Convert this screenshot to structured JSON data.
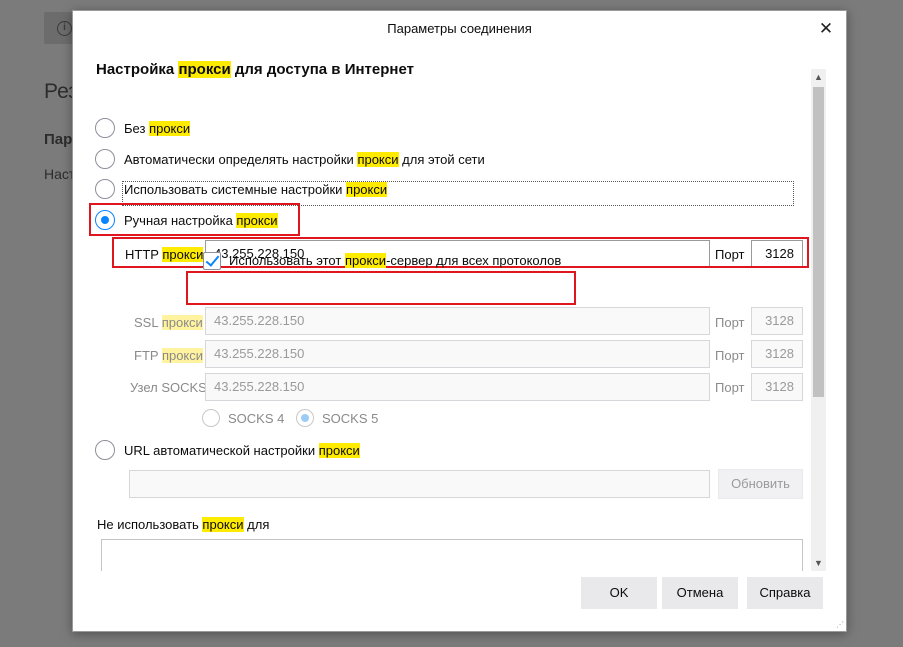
{
  "background": {
    "info_icon": "info-icon",
    "large_text": "Рез",
    "bold_text": "Пар",
    "small_text": "Наст"
  },
  "dialog": {
    "title": "Параметры соединения",
    "close_icon": "close-icon"
  },
  "section": {
    "heading_pre": "Настройка ",
    "heading_hl": "прокси",
    "heading_post": " для доступа в Интернет"
  },
  "radios": {
    "no_proxy": {
      "pre": "Без ",
      "hl": "прокси",
      "selected": false
    },
    "auto_detect": {
      "pre": "Автоматически определять настройки ",
      "hl": "прокси",
      "post": " для этой сети",
      "selected": false
    },
    "system": {
      "pre": "Использовать системные настройки ",
      "hl": "прокси",
      "selected": false
    },
    "manual": {
      "pre": "Ручная настройка ",
      "hl": "прокси",
      "selected": true
    },
    "auto_url": {
      "pre": "URL автоматической настройки ",
      "hl": "прокси",
      "selected": false
    }
  },
  "http": {
    "label_pre": "HTTP ",
    "label_hl": "прокси",
    "value": "43.255.228.150",
    "port_label": "Порт",
    "port": "3128"
  },
  "use_for_all": {
    "pre": "Использовать этот ",
    "hl": "прокси",
    "post": "-сервер для всех протоколов",
    "checked": true
  },
  "ssl": {
    "label_pre": "SSL ",
    "label_hl": "прокси",
    "value": "43.255.228.150",
    "port_label": "Порт",
    "port": "3128"
  },
  "ftp": {
    "label_pre": "FTP ",
    "label_hl": "прокси",
    "value": "43.255.228.150",
    "port_label": "Порт",
    "port": "3128"
  },
  "socks": {
    "label": "Узел SOCKS",
    "value": "43.255.228.150",
    "port_label": "Порт",
    "port": "3128",
    "v4": "SOCKS 4",
    "v5": "SOCKS 5",
    "selected": "SOCKS 5"
  },
  "auto_url_value": "",
  "reload_label": "Обновить",
  "no_proxy_for": {
    "pre": "Не использовать ",
    "hl": "прокси",
    "post": " для"
  },
  "no_proxy_list": "",
  "buttons": {
    "ok": "OK",
    "cancel": "Отмена",
    "help": "Справка"
  },
  "colors": {
    "highlight": "#ffeb00",
    "accent": "#0a84ff",
    "annotation": "#e0161e"
  }
}
